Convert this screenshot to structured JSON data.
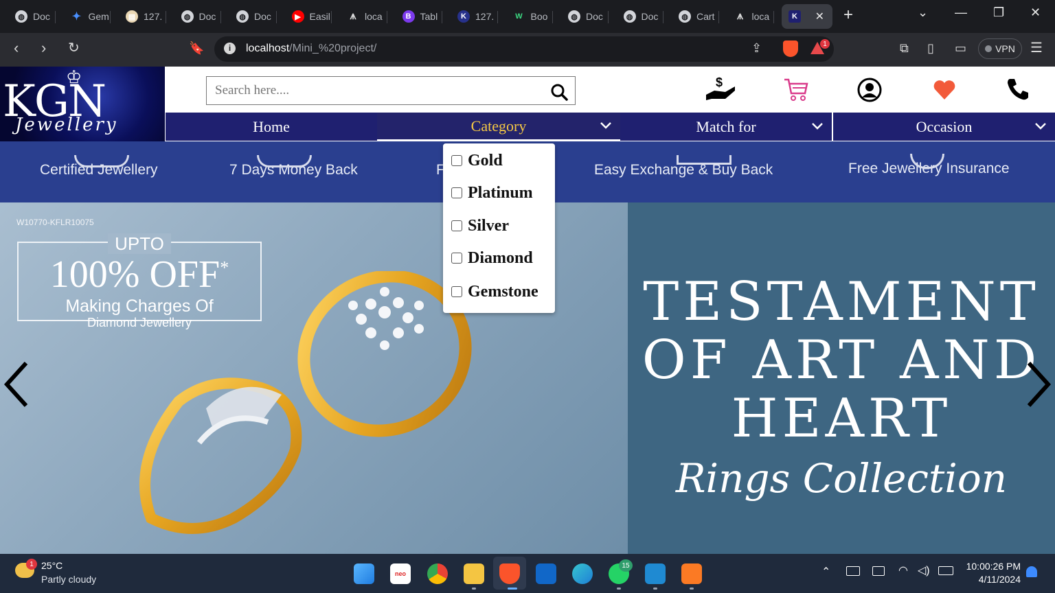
{
  "browser": {
    "tabs": [
      {
        "label": "Doc",
        "icon": "globe-icon"
      },
      {
        "label": "Gem",
        "icon": "gemini-icon"
      },
      {
        "label": "127.",
        "icon": "page-icon"
      },
      {
        "label": "Doc",
        "icon": "globe-icon"
      },
      {
        "label": "Doc",
        "icon": "globe-icon"
      },
      {
        "label": "Easil",
        "icon": "youtube-icon"
      },
      {
        "label": "loca",
        "icon": "xampp-icon"
      },
      {
        "label": "Tabl",
        "icon": "bootstrap-icon"
      },
      {
        "label": "127.",
        "icon": "kgn-icon"
      },
      {
        "label": "Boo",
        "icon": "w-icon"
      },
      {
        "label": "Doc",
        "icon": "globe-icon"
      },
      {
        "label": "Doc",
        "icon": "globe-icon"
      },
      {
        "label": "Cart",
        "icon": "globe-icon"
      },
      {
        "label": "loca",
        "icon": "xampp-icon"
      }
    ],
    "url_host": "localhost",
    "url_path": "/Mini_%20project/",
    "vpn_label": "VPN",
    "brave_badge": "1"
  },
  "site": {
    "logo_main": "KGN",
    "logo_sub": "Jewellery",
    "search_placeholder": "Search here....",
    "nav": {
      "home": "Home",
      "category": "Category",
      "match_for": "Match for",
      "occasion": "Occasion"
    },
    "features": [
      "Certified Jewellery",
      "7 Days Money Back",
      "F",
      "Easy Exchange & Buy Back",
      "Free Jewellery Insurance"
    ],
    "category_menu": [
      "Gold",
      "Platinum",
      "Silver",
      "Diamond",
      "Gemstone"
    ],
    "slide": {
      "sku": "W10770-KFLR10075",
      "upto": "UPTO",
      "off": "100% OFF",
      "off_mark": "*",
      "making": "Making Charges Of",
      "diamond": "Diamond Jewellery",
      "headline_1": "TESTAMENT",
      "headline_2": "OF ART AND",
      "headline_3": "HEART",
      "script": "Rings Collection"
    }
  },
  "taskbar": {
    "temp": "25°C",
    "weather": "Partly cloudy",
    "weather_badge": "1",
    "whatsapp_badge": "15",
    "time": "10:00:26 PM",
    "date": "4/11/2024"
  },
  "colors": {
    "nav_bg": "#1f2070",
    "category_active": "#f6c945",
    "features_bg": "#2a3f8f",
    "slide_right_bg": "#3e6682"
  }
}
